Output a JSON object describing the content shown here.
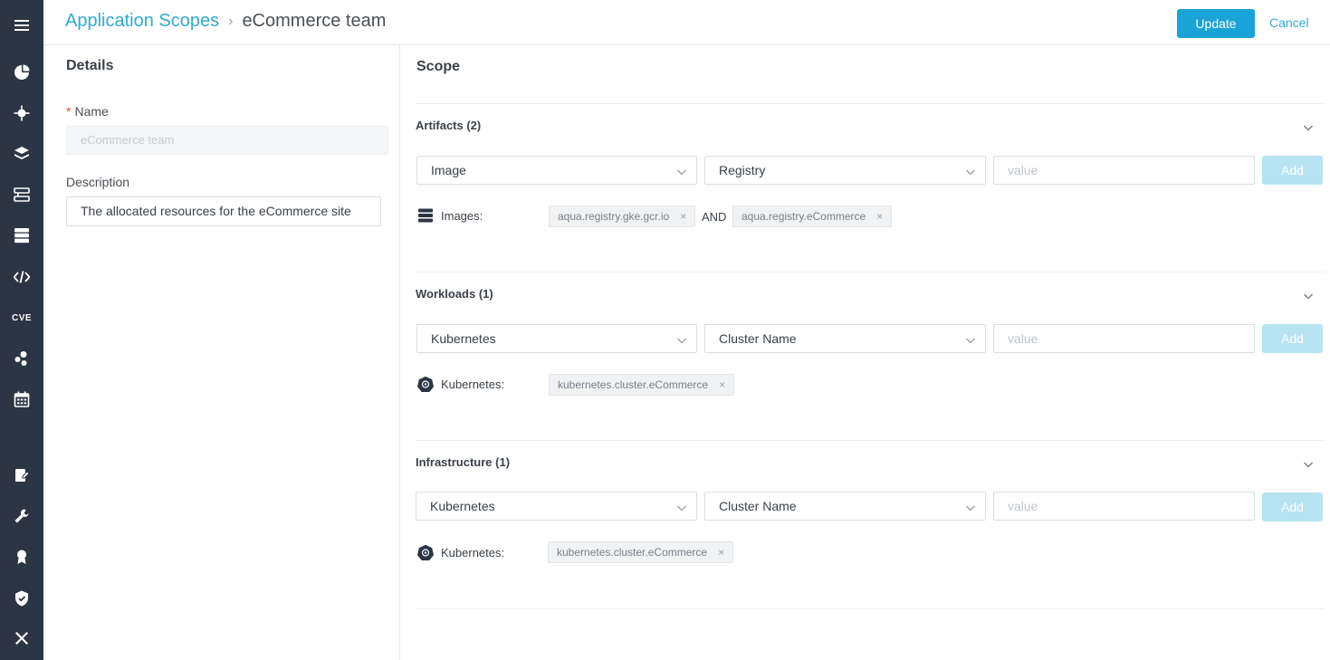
{
  "header": {
    "breadcrumb_parent": "Application Scopes",
    "breadcrumb_current": "eCommerce team",
    "update_label": "Update",
    "cancel_label": "Cancel"
  },
  "sidebar": {
    "items": [
      {
        "icon": "menu-icon"
      },
      {
        "icon": "dashboard-icon"
      },
      {
        "icon": "risk-explorer-icon"
      },
      {
        "icon": "images-icon"
      },
      {
        "icon": "workloads-icon"
      },
      {
        "icon": "infrastructure-icon"
      },
      {
        "icon": "functions-icon"
      },
      {
        "text": "CVE"
      },
      {
        "icon": "services-icon"
      },
      {
        "icon": "calendar-icon"
      },
      {
        "icon": "policies-icon"
      },
      {
        "icon": "tools-icon"
      },
      {
        "icon": "compliance-icon"
      },
      {
        "icon": "security-icon"
      },
      {
        "icon": "settings-icon"
      }
    ]
  },
  "details": {
    "title": "Details",
    "name_label": "Name",
    "name_value": "eCommerce team",
    "description_label": "Description",
    "description_value": "The allocated resources for the eCommerce site"
  },
  "scope": {
    "title": "Scope",
    "sections": [
      {
        "title": "Artifacts (2)",
        "select1": "Image",
        "select2": "Registry",
        "value_placeholder": "value",
        "add_label": "Add",
        "row_label": "Images:",
        "tags": [
          "aqua.registry.gke.gcr.io",
          "aqua.registry.eCommerce"
        ],
        "and_text": "AND"
      },
      {
        "title": "Workloads (1)",
        "select1": "Kubernetes",
        "select2": "Cluster Name",
        "value_placeholder": "value",
        "add_label": "Add",
        "row_label": "Kubernetes:",
        "tags": [
          "kubernetes.cluster.eCommerce"
        ]
      },
      {
        "title": "Infrastructure (1)",
        "select1": "Kubernetes",
        "select2": "Cluster Name",
        "value_placeholder": "value",
        "add_label": "Add",
        "row_label": "Kubernetes:",
        "tags": [
          "kubernetes.cluster.eCommerce"
        ]
      }
    ]
  },
  "colors": {
    "sidebar": "#2b3544",
    "accent": "#1aa3d6",
    "link": "#2fa9d9",
    "add_disabled": "#b6e3f2"
  }
}
